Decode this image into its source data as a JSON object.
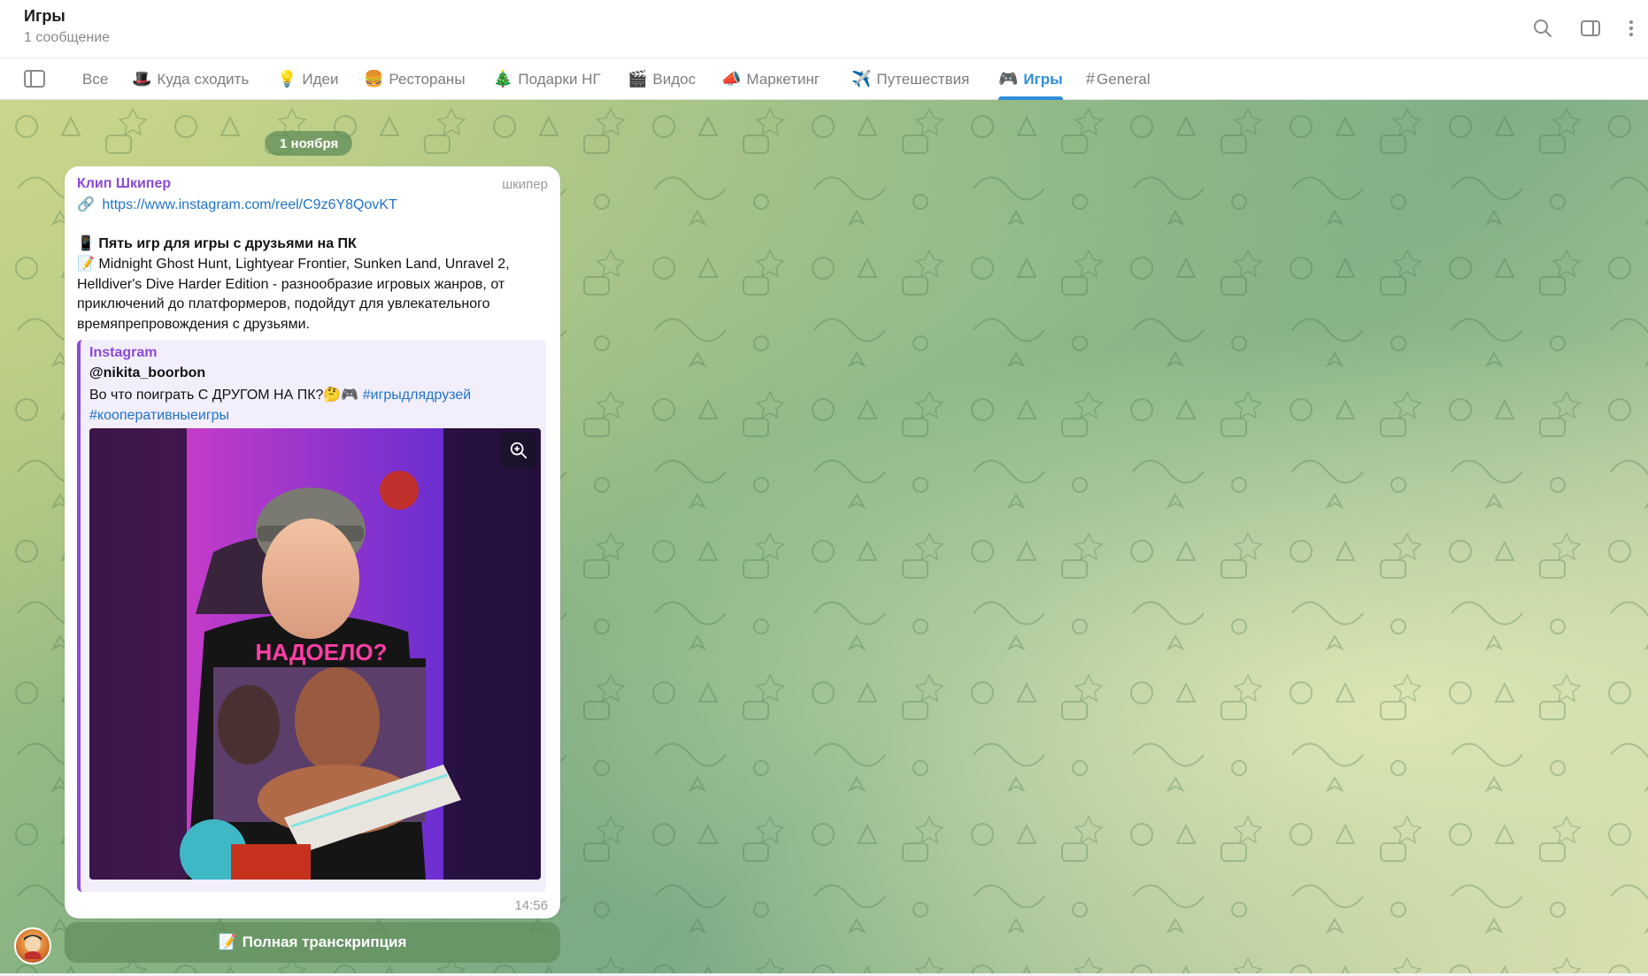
{
  "header": {
    "title": "Игры",
    "subtitle": "1 сообщение",
    "icons": [
      "search-icon",
      "sidebar-toggle-icon",
      "more-vertical-icon"
    ]
  },
  "tabs": [
    {
      "emoji": "",
      "label": "Все",
      "active": false
    },
    {
      "emoji": "🎩",
      "label": "Куда сходить",
      "active": false
    },
    {
      "emoji": "💡",
      "label": "Идеи",
      "active": false
    },
    {
      "emoji": "🍔",
      "label": "Рестораны",
      "active": false
    },
    {
      "emoji": "🎄",
      "label": "Подарки НГ",
      "active": false
    },
    {
      "emoji": "🎬",
      "label": "Видос",
      "active": false
    },
    {
      "emoji": "📣",
      "label": "Маркетинг",
      "active": false
    },
    {
      "emoji": "✈️",
      "label": "Путешествия",
      "active": false
    },
    {
      "emoji": "🎮",
      "label": "Игры",
      "active": true
    },
    {
      "emoji": "#",
      "label": "General",
      "active": false
    }
  ],
  "chat": {
    "date": "1 ноября",
    "message": {
      "sender": "Клип Шкипер",
      "badge": "шкипер",
      "link_emoji": "🔗",
      "link": "https://www.instagram.com/reel/C9z6Y8QovKT",
      "title_emoji": "📱",
      "title": "Пять игр для игры с друзьями на ПК",
      "body_emoji": "📝",
      "body": "Midnight Ghost Hunt, Lightyear Frontier, Sunken Land, Unravel 2, Helldiver's Dive Harder Edition - разнообразие игровых жанров, от приключений до платформеров, подойдут для увлекательного времяпрепровождения с друзьями.",
      "preview": {
        "site": "Instagram",
        "author": "@nikita_boorbon",
        "text": "Во что поиграть С ДРУГОМ НА ПК?🤔🎮",
        "hashtags": [
          "#игрыдлядрузей",
          "#кооперативныеигры"
        ],
        "media_caption": "НАДОЕЛО?"
      },
      "time": "14:56"
    },
    "transcript_emoji": "📝",
    "transcript_button": "Полная транскрипция"
  },
  "colors": {
    "accent": "#2f8dd8",
    "sender": "#8a4ad8",
    "link": "#1f74c9"
  }
}
